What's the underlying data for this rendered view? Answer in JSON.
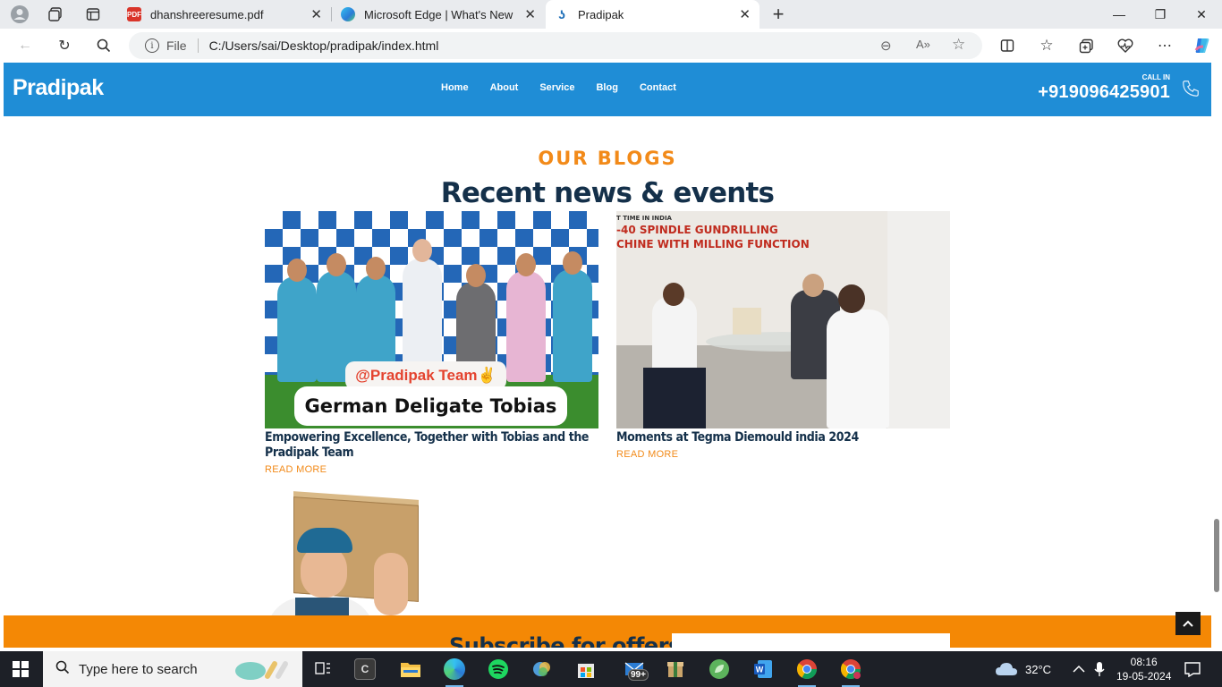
{
  "browser": {
    "tabs": [
      {
        "title": "dhanshreeresume.pdf",
        "favicon": "pdf-icon"
      },
      {
        "title": "Microsoft Edge | What's New",
        "favicon": "edge-icon"
      },
      {
        "title": "Pradipak",
        "favicon": "pradipak-icon"
      }
    ],
    "address": {
      "scheme_label": "File",
      "url": "C:/Users/sai/Desktop/pradipak/index.html"
    }
  },
  "site": {
    "logo": "Pradipak",
    "menu": [
      "Home",
      "About",
      "Service",
      "Blog",
      "Contact"
    ],
    "call_label": "CALL IN",
    "phone": "+919096425901",
    "brand_color": "#1f8dd6",
    "accent_color": "#f28a19"
  },
  "blog": {
    "eyebrow": "OUR BLOGS",
    "heading": "Recent news & events",
    "posts": [
      {
        "title": "Empowering Excellence, Together with Tobias and the Pradipak Team",
        "read_more": "READ MORE",
        "image_caption_1": "@Pradipak Team✌",
        "image_caption_2": "German Deligate Tobias"
      },
      {
        "title": "Moments at Tegma Diemould india 2024",
        "read_more": "READ MORE",
        "poster_line_1": "T TIME IN INDIA",
        "poster_line_2": "-40 SPINDLE GUNDRILLING",
        "poster_line_3": "CHINE WITH MILLING FUNCTION"
      }
    ]
  },
  "subscribe": {
    "text": "Subscribe for offers"
  },
  "taskbar": {
    "search_placeholder": "Type here to search",
    "mail_badge": "99+",
    "weather": "32°C",
    "time": "08:16",
    "date": "19-05-2024"
  }
}
